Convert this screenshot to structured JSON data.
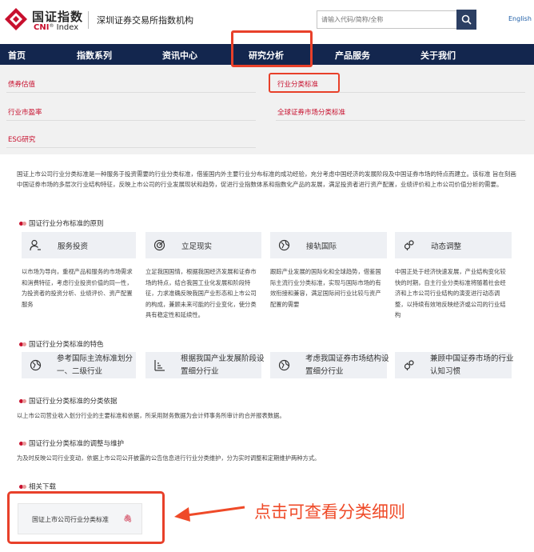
{
  "header": {
    "logo_cn": "国证指数",
    "logo_en_brand": "CNI",
    "logo_en_tail": "Index",
    "slogan": "深圳证券交易所指数机构",
    "search_placeholder": "请输入代码/简称/全称",
    "language_link": "English"
  },
  "nav": {
    "items": [
      "首页",
      "指数系列",
      "资讯中心",
      "研究分析",
      "产品服务",
      "关于我们"
    ]
  },
  "dropdown": {
    "left": [
      "债券估值",
      "行业市盈率",
      "ESG研究"
    ],
    "right": [
      "行业分类标准",
      "全球证券市场分类标准"
    ]
  },
  "intro": "国证上市公司行业分类标准是一种服务于投资需要的行业分类标准，借鉴国内外主要行业分布标准的成功经验，充分考虑中国经济的发展阶段及中国证券市场的特点而建立。该标准 旨在刻画中国证券市场的多层次行业结构特征，反映上市公司的行业发展现状和趋势，促进行业指数体系和指数化产品的发展，满足投资者进行资产配置，业绩评价和上市公司价值分析的需要。",
  "principles": {
    "title": "国证行业分布标准的原则",
    "items": [
      {
        "label": "服务投资",
        "icon": "person-icon",
        "desc": "以市场为导向，重视产品和服务的市场需求和消费特征，考虑行业投资价值的同一性，为投资者的投资分析、业绩评价、资产配置服务"
      },
      {
        "label": "立足现实",
        "icon": "target-icon",
        "desc": "立足我国国情，根据我国经济发展和证券市场的特点，结合我国工业化发展和阶段特征，力求准确反映我国产业形态和上市公司的构成，兼顾未来可能的行业变化，使分类 具有稳定性和延续性。"
      },
      {
        "label": "接轨国际",
        "icon": "globe-icon",
        "desc": "跟踪产业发展的国际化和全球趋势，借鉴国际主流行业分类标准，实现与国际市场的有效衔接和兼容，满足国际间行业比较与资产配置的需要"
      },
      {
        "label": "动态调整",
        "icon": "gears-icon",
        "desc": "中国正处于经济快速发展，产业结构变化较快的时期，自主行业分类标准将随着社会经济和上市公司行业结构的演变进行动态调整，以持续有效地反映经济或公司的行业结构"
      }
    ]
  },
  "features": {
    "title": "国证行业分类标准的特色",
    "items": [
      {
        "label": "参考国际主流标准划分一、二级行业",
        "icon": "globe-icon"
      },
      {
        "label": "根据我国产业发展阶段设置细分行业",
        "icon": "chart-bars-icon"
      },
      {
        "label": "考虑我国证券市场结构设置细分行业",
        "icon": "globe-icon"
      },
      {
        "label": "兼顾中国证券市场的行业认知习惯",
        "icon": "gears-icon"
      }
    ]
  },
  "basis": {
    "title": "国证行业分类标准的分类依据",
    "text": "以上市公司营业收入划分行业的主要标准和依据，所采用财务数据为会计师事务所审计的合并报表数据。"
  },
  "maintenance": {
    "title": "国证行业分类标准的调整与维护",
    "text": "为及时反映公司行业变动，依据上市公司公开披露的公告信息进行行业分类维护，分为实时调整和定期维护两种方式。"
  },
  "downloads": {
    "title": "相关下载",
    "file_label": "国证上市公司行业分类标准",
    "file_icon": "paperclip-icon"
  },
  "annotation": {
    "callout": "点击可查看分类细则",
    "color": "#ef4a28"
  },
  "colors": {
    "nav_bg": "#13264e",
    "accent_red": "#c8102e",
    "search_button": "#2c3f63"
  }
}
